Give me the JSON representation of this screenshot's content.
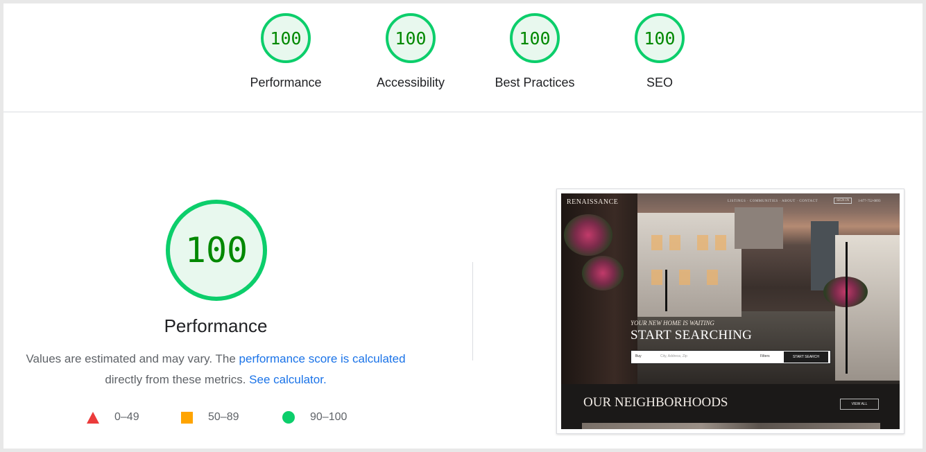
{
  "summary": {
    "gauges": [
      {
        "label": "Performance",
        "score": "100"
      },
      {
        "label": "Accessibility",
        "score": "100"
      },
      {
        "label": "Best Practices",
        "score": "100"
      },
      {
        "label": "SEO",
        "score": "100"
      }
    ]
  },
  "performance": {
    "score": "100",
    "title": "Performance",
    "desc_prefix": "Values are estimated and may vary. The ",
    "desc_link": "performance score is calculated",
    "desc_middle": " directly from these metrics. ",
    "calc_link": "See calculator."
  },
  "legend": [
    {
      "range": "0–49",
      "color": "#eb3b3b"
    },
    {
      "range": "50–89",
      "color": "#ffa400"
    },
    {
      "range": "90–100",
      "color": "#0cce6b"
    }
  ],
  "screenshot": {
    "brand": "RENAISSANCE",
    "nav": "LISTINGS · COMMUNITIES · ABOUT · CONTACT",
    "signin": "SIGN IN",
    "phone": "1-877-752-0893",
    "tagline": "YOUR NEW HOME IS WAITING",
    "hero": "START SEARCHING",
    "search_type": "Buy",
    "search_placeholder": "City, Address, Zip",
    "filters": "Filters",
    "search_button": "START SEARCH",
    "section_title": "OUR NEIGHBORHOODS",
    "view_all": "VIEW ALL"
  },
  "colors": {
    "pass": "#0cce6b",
    "pass_text": "#008800",
    "link": "#1a73e8"
  }
}
